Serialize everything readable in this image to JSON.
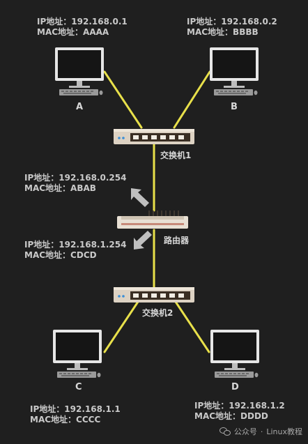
{
  "hosts": {
    "A": {
      "name": "A",
      "ip_label": "IP地址：",
      "ip": "192.168.0.1",
      "mac_label": "MAC地址：",
      "mac": "AAAA"
    },
    "B": {
      "name": "B",
      "ip_label": "IP地址：",
      "ip": "192.168.0.2",
      "mac_label": "MAC地址：",
      "mac": "BBBB"
    },
    "C": {
      "name": "C",
      "ip_label": "IP地址：",
      "ip": "192.168.1.1",
      "mac_label": "MAC地址：",
      "mac": "CCCC"
    },
    "D": {
      "name": "D",
      "ip_label": "IP地址：",
      "ip": "192.168.1.2",
      "mac_label": "MAC地址：",
      "mac": "DDDD"
    }
  },
  "switch1": {
    "label": "交换机1"
  },
  "switch2": {
    "label": "交换机2"
  },
  "router": {
    "label": "路由器",
    "port0": {
      "ip_label": "IP地址：",
      "ip": "192.168.0.254",
      "mac_label": "MAC地址：",
      "mac": "ABAB"
    },
    "port1": {
      "ip_label": "IP地址：",
      "ip": "192.168.1.254",
      "mac_label": "MAC地址：",
      "mac": "CDCD"
    }
  },
  "colors": {
    "background": "#1f1f1f",
    "link": "#e8e04a",
    "text": "#c9c9c9"
  },
  "footer": {
    "icon": "wechat-icon",
    "prefix": "公众号",
    "dot": "·",
    "name": "Linux教程"
  }
}
